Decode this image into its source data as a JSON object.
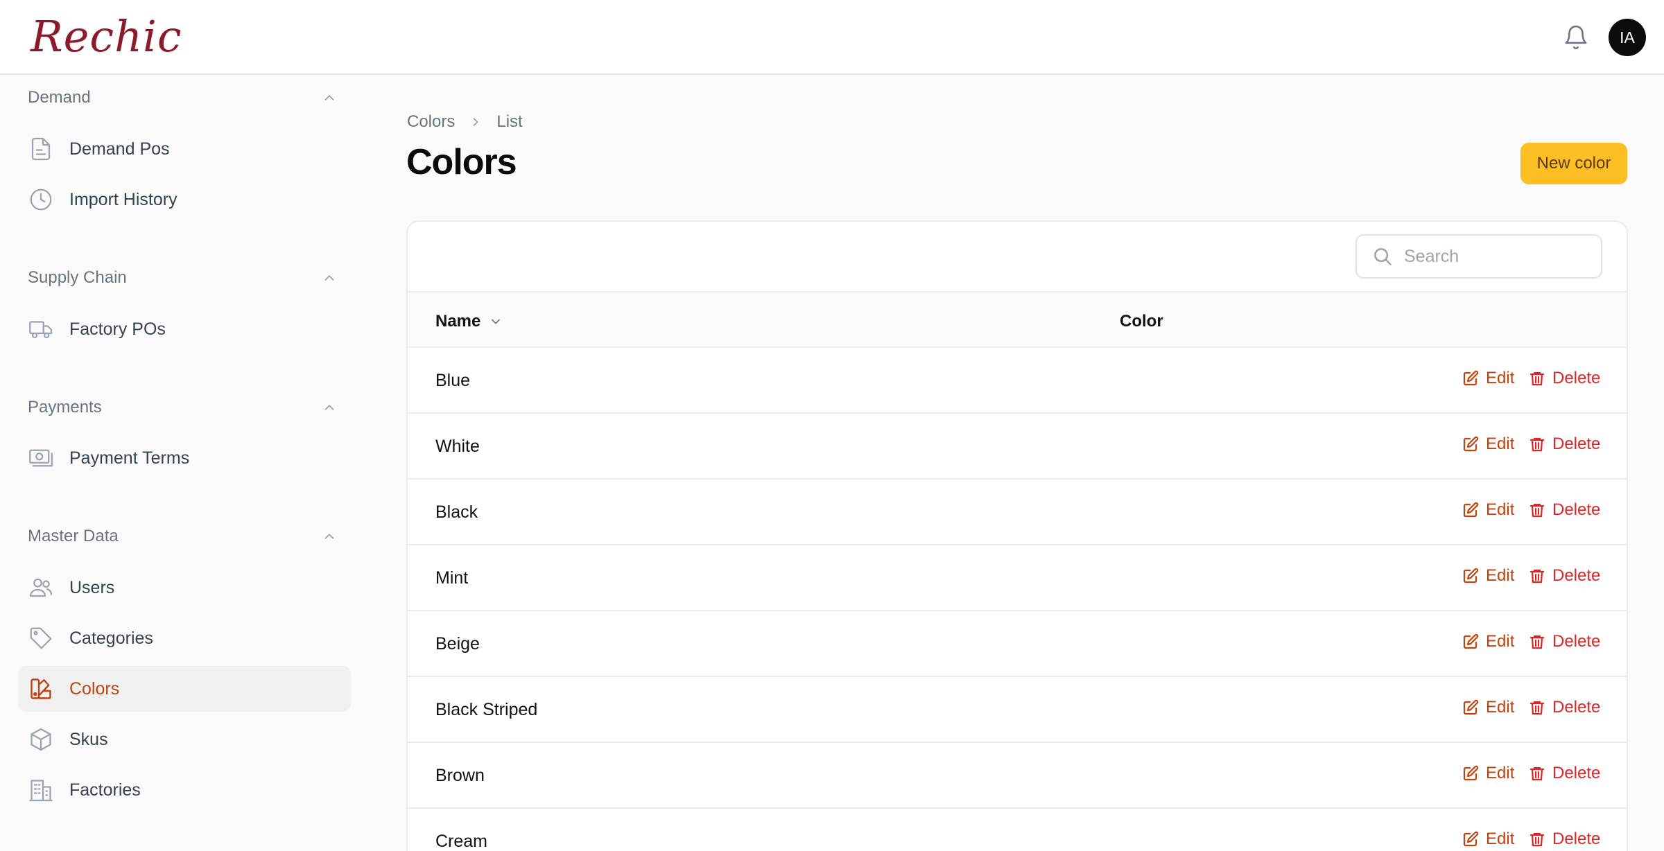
{
  "brand": {
    "name": "Rechic",
    "color": "#8b1a2b"
  },
  "header": {
    "avatar_initials": "IA",
    "bell_icon": "bell-icon"
  },
  "sidebar": {
    "groups": [
      {
        "label": "Demand",
        "items": [
          {
            "label": "Demand Pos",
            "icon": "document-icon"
          },
          {
            "label": "Import History",
            "icon": "clock-icon"
          }
        ]
      },
      {
        "label": "Supply Chain",
        "items": [
          {
            "label": "Factory POs",
            "icon": "truck-icon"
          }
        ]
      },
      {
        "label": "Payments",
        "items": [
          {
            "label": "Payment Terms",
            "icon": "banknote-icon"
          }
        ]
      },
      {
        "label": "Master Data",
        "items": [
          {
            "label": "Users",
            "icon": "users-icon"
          },
          {
            "label": "Categories",
            "icon": "tag-icon"
          },
          {
            "label": "Colors",
            "icon": "swatch-icon",
            "active": true
          },
          {
            "label": "Skus",
            "icon": "cube-icon"
          },
          {
            "label": "Factories",
            "icon": "building-icon"
          }
        ]
      }
    ]
  },
  "breadcrumb": [
    "Colors",
    "List"
  ],
  "page": {
    "title": "Colors",
    "new_button": "New color"
  },
  "search": {
    "placeholder": "Search"
  },
  "table": {
    "columns": [
      "Name",
      "Color"
    ],
    "sort_icon": "chevron-down-icon",
    "edit_label": "Edit",
    "delete_label": "Delete",
    "rows": [
      "Blue",
      "White",
      "Black",
      "Mint",
      "Beige",
      "Black Striped",
      "Brown",
      "Cream"
    ]
  },
  "colors": {
    "accent": "#c2410c",
    "danger": "#dc2626",
    "button": "#fbbf24"
  }
}
